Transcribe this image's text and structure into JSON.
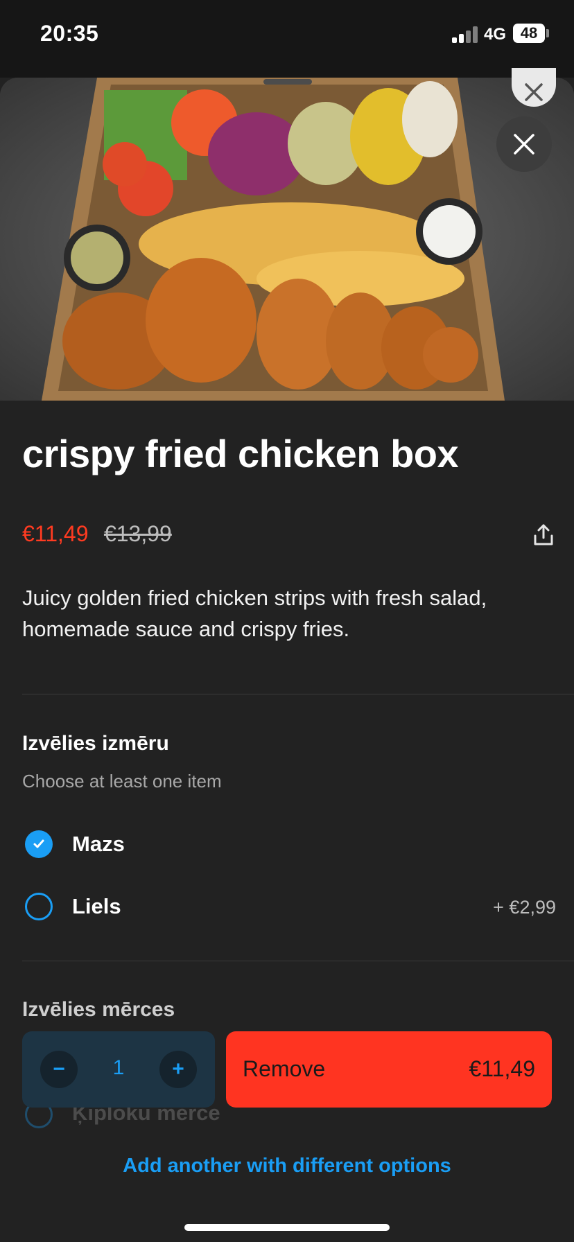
{
  "status_bar": {
    "time": "20:35",
    "network": "4G",
    "battery": "48"
  },
  "product": {
    "title": "crispy fried chicken box",
    "price": "€11,49",
    "old_price": "€13,99",
    "description": "Juicy golden fried chicken strips with  fresh salad, homemade sauce and crispy fries."
  },
  "size_section": {
    "title": "Izvēlies izmēru",
    "subtitle": "Choose at least one item",
    "options": [
      {
        "label": "Mazs",
        "price": "",
        "selected": true
      },
      {
        "label": "Liels",
        "price": "+ €2,99",
        "selected": false
      }
    ]
  },
  "sauce_section": {
    "title": "Izvēlies mērces",
    "first_option_label": "Ķiploku mērce"
  },
  "cart": {
    "quantity": "1",
    "decrement_icon": "−",
    "increment_icon": "+",
    "remove_label": "Remove",
    "remove_price": "€11,49",
    "add_another_label": "Add another with different options"
  },
  "colors": {
    "accent_blue": "#1a9ef5",
    "price_red": "#ff3b21",
    "remove_button": "#ff3421",
    "background": "#222222"
  }
}
